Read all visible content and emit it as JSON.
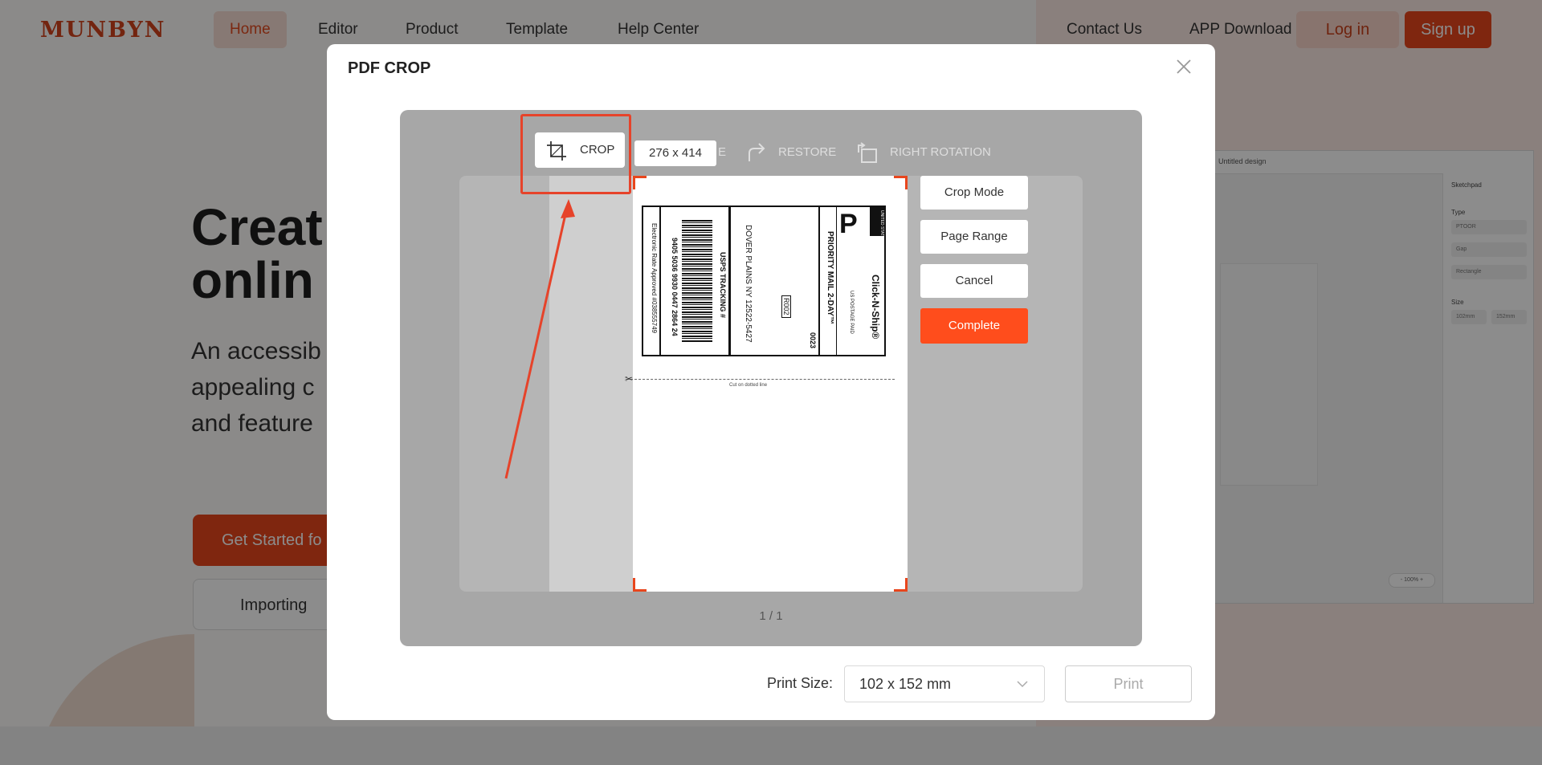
{
  "site": {
    "logo": "MUNBYN",
    "nav": [
      "Home",
      "Editor",
      "Product",
      "Template",
      "Help Center"
    ],
    "nav_right": [
      "Contact Us",
      "APP Download"
    ],
    "login": "Log in",
    "signup": "Sign up",
    "hero_title_1": "Creat",
    "hero_title_2": "onlin",
    "hero_sub_1": "An accessib",
    "hero_sub_2": "appealing c",
    "hero_sub_3": "and feature",
    "hero_btn": "Get Started fo",
    "hero_btn2": "Importing",
    "preview_title": "Untitled design",
    "preview_panel_title": "Sketchpad",
    "preview_type_label": "Type",
    "preview_type_opts": [
      "PTOOR",
      "Gap",
      "Rectangle"
    ],
    "preview_size_label": "Size",
    "preview_size_w": "102mm",
    "preview_size_h": "152mm",
    "preview_zoom": "-  100%  +"
  },
  "modal": {
    "title": "PDF CROP",
    "toolbar": {
      "crop": "CROP",
      "hidden_suffix": "E",
      "restore": "RESTORE",
      "right_rotation": "RIGHT ROTATION"
    },
    "dims": "276 x 414",
    "side_buttons": {
      "crop_mode": "Crop Mode",
      "page_range": "Page Range",
      "cancel": "Cancel",
      "complete": "Complete"
    },
    "pager": "1 / 1",
    "print_size_label": "Print Size:",
    "print_size_value": "102 x 152 mm",
    "print": "Print"
  },
  "label": {
    "service": "PRIORITY MAIL 2-DAY™",
    "brand": "Click-N-Ship®",
    "big_p": "P",
    "usps": "UNITED STATES POSTAL SERVICE",
    "to_city": "DOVER PLAINS NY 12522-5427",
    "tracking_title": "USPS TRACKING #",
    "tracking_no": "9405 5036 9930 0447 2864 24",
    "approved": "Electronic Rate Approved #038555749",
    "code": "R002",
    "zone": "0023",
    "postage": "US POSTAGE PAID",
    "cut": "Cut on dotted line"
  },
  "colors": {
    "accent": "#e8461d",
    "complete": "#ff4d1c",
    "annotation": "#e6432a"
  }
}
